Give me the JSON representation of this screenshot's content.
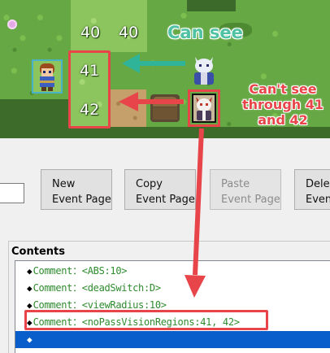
{
  "map": {
    "regions": [
      "40",
      "40",
      "41",
      "42"
    ],
    "annotations": {
      "can_see": "Can see",
      "cant_see": [
        "Can't see",
        "through 41",
        "and 42"
      ]
    },
    "colors": {
      "annotation_green": "#4ec2a2",
      "annotation_red": "#e8454a",
      "selection_cyan": "#49b2c8"
    },
    "characters": [
      "player-hero",
      "event-guard-blue",
      "event-guard-white"
    ]
  },
  "toolbar": {
    "buttons": [
      {
        "line1": "New",
        "line2": "Event Page",
        "enabled": true
      },
      {
        "line1": "Copy",
        "line2": "Event Page",
        "enabled": true
      },
      {
        "line1": "Paste",
        "line2": "Event Page",
        "enabled": false
      },
      {
        "line1": "Dele",
        "line2": "Even",
        "enabled": true
      }
    ]
  },
  "contents": {
    "title": "Contents",
    "rows": [
      {
        "marker": "◆",
        "text": "Comment：<ABS:10>"
      },
      {
        "marker": "◆",
        "text": "Comment：<deadSwitch:D>"
      },
      {
        "marker": "◆",
        "text": "Comment：<viewRadius:10>"
      },
      {
        "marker": "◆",
        "text": "Comment：<noPassVisionRegions:41, 42>"
      },
      {
        "marker": "◆",
        "text": ""
      }
    ],
    "selected_index": 4,
    "selection_color": "#0a5ecb",
    "comment_color": "#2e8b2e"
  }
}
